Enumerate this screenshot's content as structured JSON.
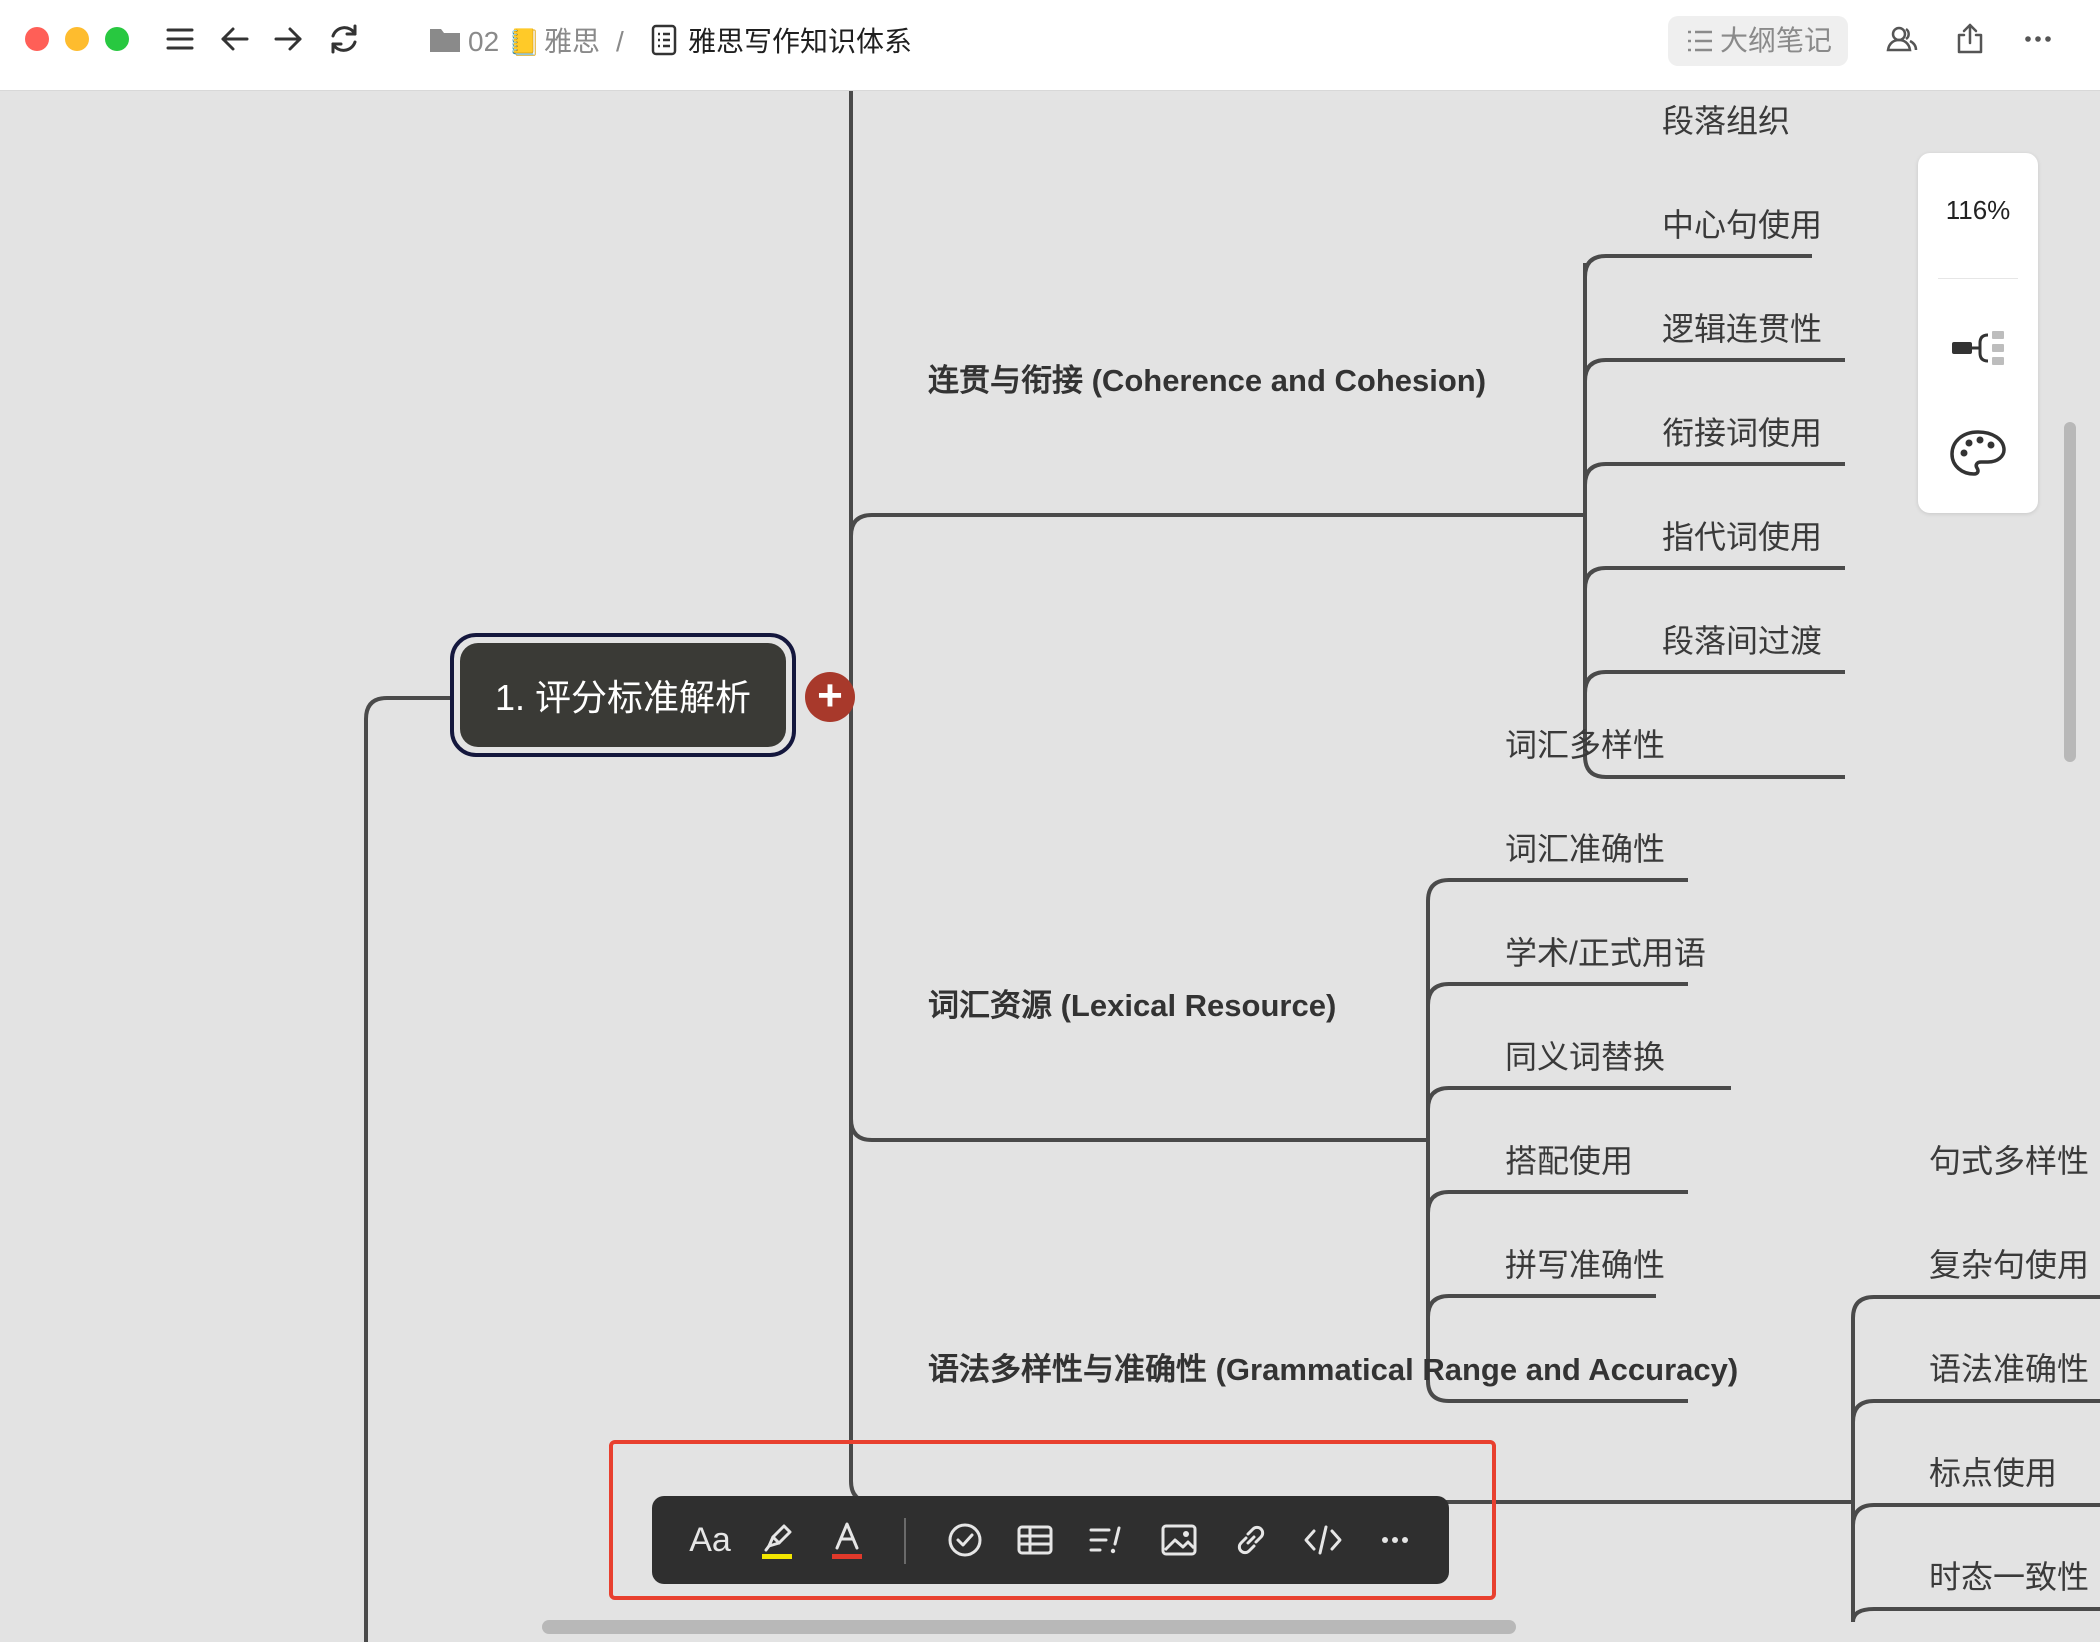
{
  "window": {
    "breadcrumb": {
      "folder": "02",
      "notebook_emoji": "📒",
      "notebook": "雅思",
      "separator": "/"
    },
    "document_title": "雅思写作知识体系",
    "outline_button": "大纲笔记",
    "traffic_colors": [
      "#ff5f57",
      "#febc2e",
      "#28c840"
    ]
  },
  "mindmap": {
    "root": "1. 评分标准解析",
    "branches": [
      {
        "label": "连贯与衔接 (Coherence and Cohesion)",
        "children": [
          "段落组织",
          "中心句使用",
          "逻辑连贯性",
          "衔接词使用",
          "指代词使用",
          "段落间过渡"
        ]
      },
      {
        "label": "词汇资源 (Lexical Resource)",
        "children": [
          "词汇多样性",
          "词汇准确性",
          "学术/正式用语",
          "同义词替换",
          "搭配使用",
          "拼写准确性"
        ]
      },
      {
        "label": "语法多样性与准确性 (Grammatical Range and Accuracy)",
        "children": [
          "句式多样性",
          "复杂句使用",
          "语法准确性",
          "标点使用",
          "时态一致性"
        ]
      }
    ]
  },
  "side_panel": {
    "zoom": "116%"
  },
  "format_toolbar": {
    "text_style_label": "Aa",
    "highlight_color": "#f2e600",
    "font_color": "#e0392b"
  },
  "accent_colors": {
    "add_button": "#a8392b",
    "selection_frame": "#e8402f",
    "root_border": "#14173d"
  }
}
